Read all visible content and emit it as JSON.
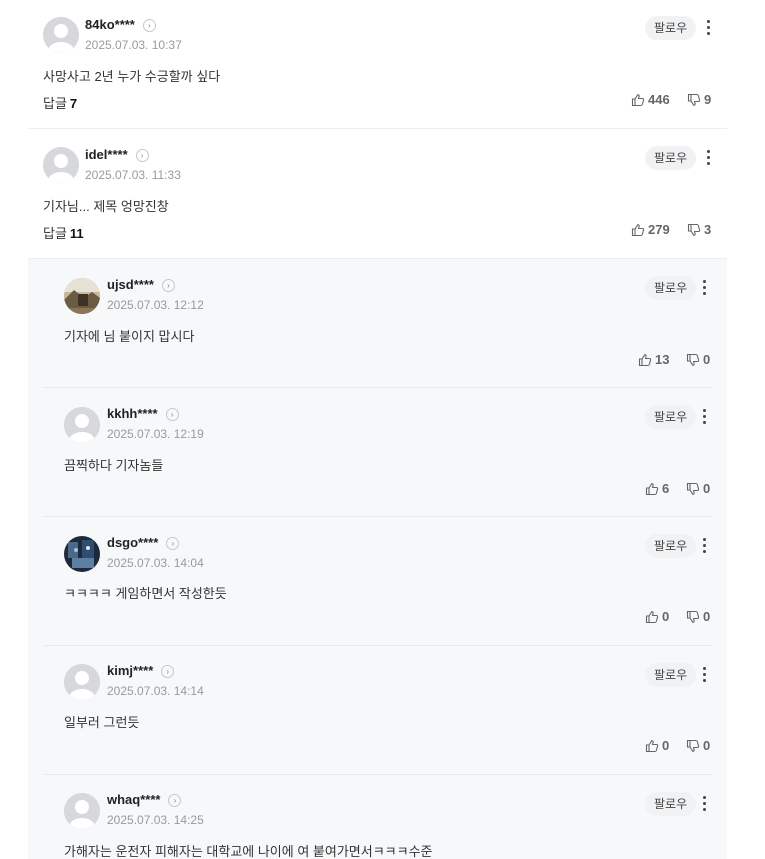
{
  "comments": [
    {
      "nickname": "84ko****",
      "date": "2025.07.03. 10:37",
      "text": "사망사고 2년 누가 수긍할까 싶다",
      "replies_label": "답글",
      "replies_count": "7",
      "likes": "446",
      "dislikes": "9",
      "follow_label": "팔로우"
    },
    {
      "nickname": "idel****",
      "date": "2025.07.03. 11:33",
      "text": "기자님... 제목 엉망진창",
      "replies_label": "답글",
      "replies_count": "11",
      "likes": "279",
      "dislikes": "3",
      "follow_label": "팔로우"
    }
  ],
  "replies": [
    {
      "nickname": "ujsd****",
      "date": "2025.07.03. 12:12",
      "text": "기자에 님 붙이지 맙시다",
      "likes": "13",
      "dislikes": "0",
      "follow_label": "팔로우",
      "avatar": "photo-landscape"
    },
    {
      "nickname": "kkhh****",
      "date": "2025.07.03. 12:19",
      "text": "끔찍하다 기자놈들",
      "likes": "6",
      "dislikes": "0",
      "follow_label": "팔로우",
      "avatar": "default"
    },
    {
      "nickname": "dsgo****",
      "date": "2025.07.03. 14:04",
      "text": "ㅋㅋㅋㅋ 게임하면서 작성한듯",
      "likes": "0",
      "dislikes": "0",
      "follow_label": "팔로우",
      "avatar": "photo-dark"
    },
    {
      "nickname": "kimj****",
      "date": "2025.07.03. 14:14",
      "text": "일부러 그런듯",
      "likes": "0",
      "dislikes": "0",
      "follow_label": "팔로우",
      "avatar": "default"
    },
    {
      "nickname": "whaq****",
      "date": "2025.07.03. 14:25",
      "text": "가해자는 운전자 피해자는 대학교에 나이에 여 붙여가면서ㅋㅋㅋ수준",
      "follow_label": "팔로우",
      "avatar": "default"
    }
  ],
  "colors": {
    "reply_background": "#f7f8fa",
    "follow_background": "#f1f2f4",
    "meta_text": "#9a9a9a"
  },
  "icons": {
    "like": "thumbs-up-icon",
    "dislike": "thumbs-down-icon",
    "more": "more-vertical-icon",
    "profile": "chevron-right-circle-icon"
  }
}
